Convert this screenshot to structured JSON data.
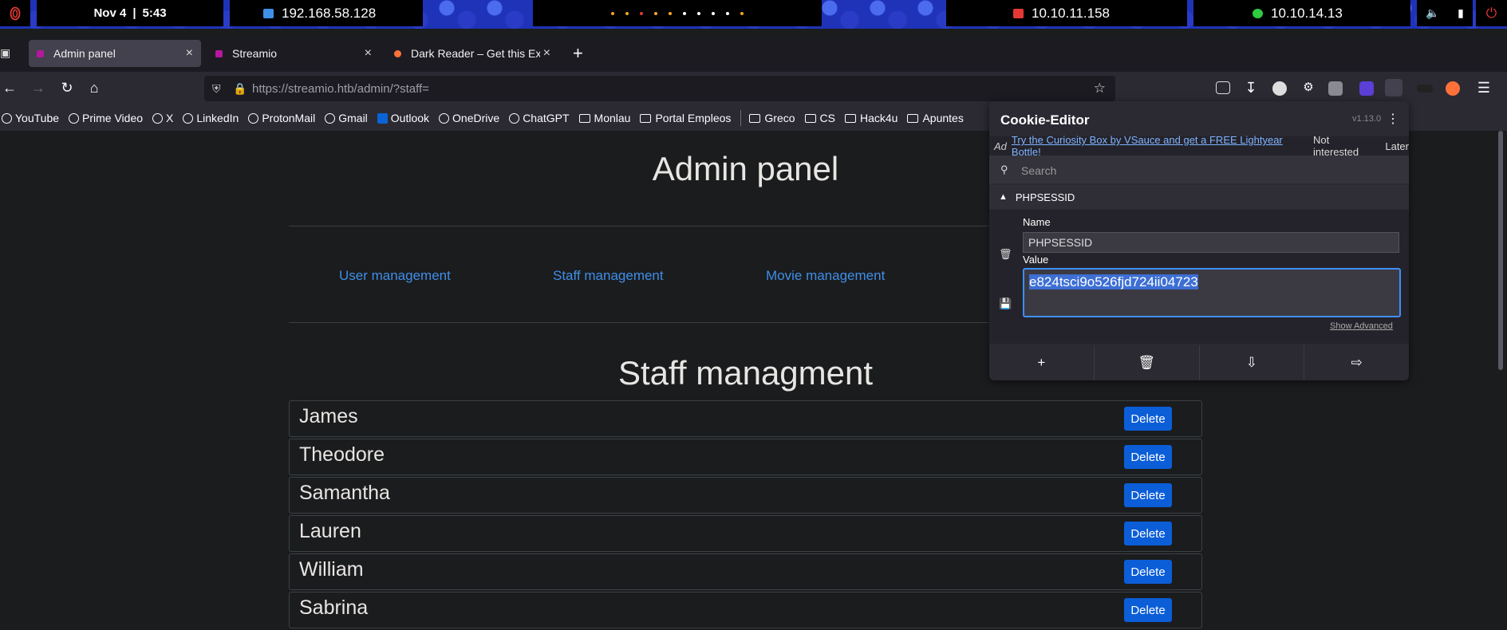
{
  "sysbar": {
    "date": "Nov 4",
    "time": "5:43",
    "ip_host": "192.168.58.128",
    "ip_target": "10.10.11.158",
    "ip_vpn": "10.10.14.13",
    "dot_colors": [
      "#f5a623",
      "#f5a623",
      "#e53935",
      "#f5a623",
      "#f5a623",
      "#ffffff",
      "#ffffff",
      "#ffffff",
      "#ffffff",
      "#f5a623"
    ]
  },
  "tabs": [
    {
      "label": "Admin panel",
      "favicon_color": "#b5179e"
    },
    {
      "label": "Streamio",
      "favicon_color": "#b5179e"
    },
    {
      "label": "Dark Reader – Get this Exte",
      "favicon_color": "#ff7139"
    }
  ],
  "url": "https://streamio.htb/admin/?staff=",
  "bookmarks": [
    {
      "label": "YouTube",
      "icon": "globe-icon"
    },
    {
      "label": "Prime Video",
      "icon": "globe-icon"
    },
    {
      "label": "X",
      "icon": "x-logo-icon"
    },
    {
      "label": "LinkedIn",
      "icon": "globe-icon"
    },
    {
      "label": "ProtonMail",
      "icon": "globe-icon"
    },
    {
      "label": "Gmail",
      "icon": "globe-icon"
    },
    {
      "label": "Outlook",
      "icon": "outlook-icon"
    },
    {
      "label": "OneDrive",
      "icon": "globe-icon"
    },
    {
      "label": "ChatGPT",
      "icon": "globe-icon"
    },
    {
      "label": "Monlau",
      "icon": "folder-icon"
    },
    {
      "label": "Portal Empleos",
      "icon": "folder-icon"
    },
    {
      "label": "Greco",
      "icon": "folder-icon"
    },
    {
      "label": "CS",
      "icon": "folder-icon"
    },
    {
      "label": "Hack4u",
      "icon": "folder-icon"
    },
    {
      "label": "Apuntes",
      "icon": "folder-icon"
    }
  ],
  "page": {
    "title": "Admin panel",
    "nav": [
      "User management",
      "Staff management",
      "Movie management"
    ],
    "section_title": "Staff managment",
    "delete_label": "Delete",
    "staff": [
      "James",
      "Theodore",
      "Samantha",
      "Lauren",
      "William",
      "Sabrina"
    ]
  },
  "cookie_editor": {
    "title": "Cookie-Editor",
    "version": "v1.13.0",
    "ad_label": "Ad",
    "ad_text": "Try the Curiosity Box by VSauce and get a FREE Lightyear Bottle!",
    "ad_not_interested": "Not interested",
    "ad_later": "Later",
    "search_placeholder": "Search",
    "cookie_name_header": "PHPSESSID",
    "name_label": "Name",
    "name_value": "PHPSESSID",
    "value_label": "Value",
    "value_value": "e824tsci9o526fjd724ii04723",
    "show_advanced": "Show Advanced"
  },
  "colors": {
    "accent_link": "#3f8ee8",
    "delete_button": "#0b5ed7",
    "page_bg": "#1b1c1e"
  }
}
